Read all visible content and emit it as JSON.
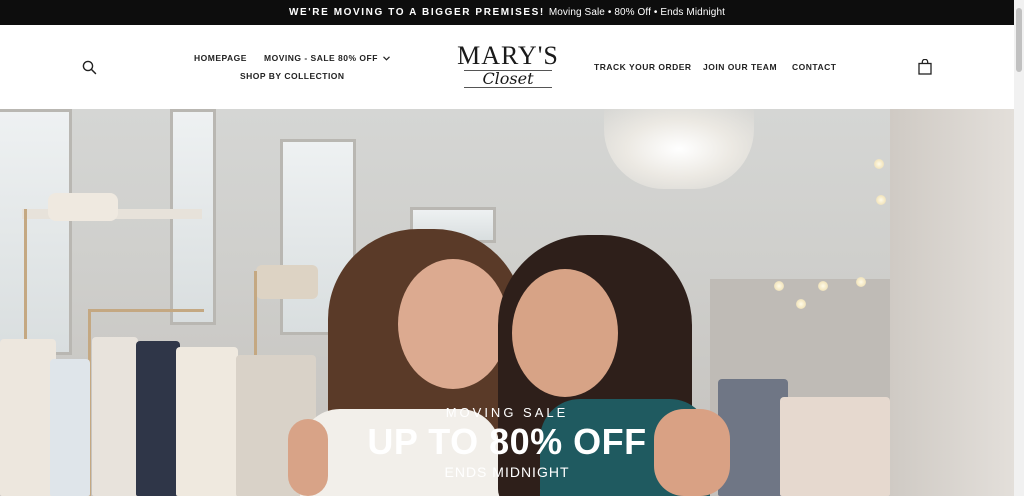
{
  "announcement": {
    "bold": "WE'RE MOVING TO A BIGGER PREMISES!",
    "rest": "Moving Sale • 80% Off • Ends Midnight"
  },
  "nav": {
    "homepage": "HOMEPAGE",
    "moving_sale": "MOVING - SALE 80% OFF",
    "shop_by_collection": "SHOP BY COLLECTION",
    "track_order": "TRACK YOUR ORDER",
    "join_team": "JOIN OUR TEAM",
    "contact": "CONTACT"
  },
  "logo": {
    "line1": "MARY'S",
    "line2": "Closet"
  },
  "hero": {
    "subtitle": "MOVING SALE",
    "headline": "UP TO 80% OFF",
    "ends": "ENDS MIDNIGHT"
  },
  "icons": {
    "search": "search-icon",
    "cart": "shopping-bag-icon",
    "dropdown": "chevron-down-icon"
  },
  "colors": {
    "announcement_bg": "#0d0d0d",
    "header_bg": "#ffffff",
    "text": "#222222"
  }
}
